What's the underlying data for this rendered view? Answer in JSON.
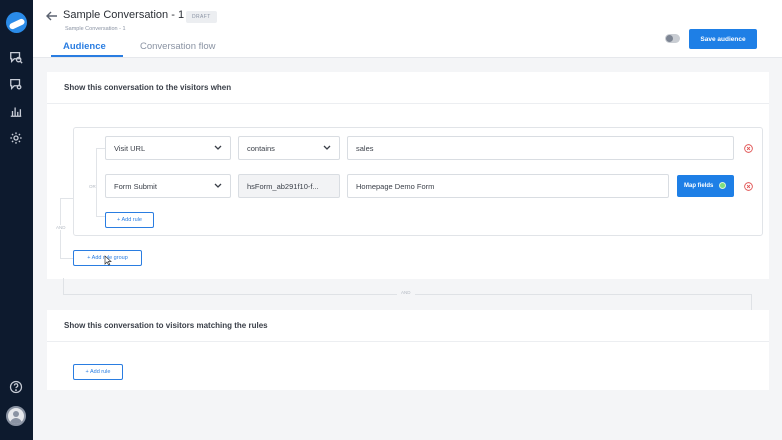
{
  "sidebar": {
    "items": [
      {
        "icon": "chat-search-icon"
      },
      {
        "icon": "chat-settings-icon"
      },
      {
        "icon": "bar-chart-icon"
      },
      {
        "icon": "gear-icon"
      }
    ],
    "bottom": [
      {
        "icon": "help-icon"
      },
      {
        "icon": "avatar"
      }
    ]
  },
  "header": {
    "title": "Sample Conversation - 1",
    "badge": "DRAFT",
    "subtitle": "Sample Conversation - 1",
    "tabs": [
      {
        "label": "Audience",
        "active": true
      },
      {
        "label": "Conversation flow",
        "active": false
      }
    ],
    "save_label": "Save audience"
  },
  "visitors_panel": {
    "title": "Show this conversation to the visitors when",
    "rule_group": {
      "connector_label": "OR",
      "rules": [
        {
          "field": "Visit URL",
          "operator": "contains",
          "value": "sales"
        },
        {
          "field": "Form Submit",
          "operator": "hsForm_ab291f10-f...",
          "value": "Homepage Demo Form",
          "action_label": "Map fields"
        }
      ],
      "add_rule_label": "+ Add rule"
    },
    "group_connector_label": "AND",
    "add_rule_group_label": "+ Add rule group"
  },
  "between_connector_label": "AND",
  "matching_panel": {
    "title": "Show this conversation to visitors matching the rules",
    "add_rule_label": "+ Add rule"
  },
  "colors": {
    "sidebar_bg": "#0d1a2e",
    "accent": "#1e7fe6",
    "delete": "#e05252",
    "status_dot": "#7ee07e"
  }
}
